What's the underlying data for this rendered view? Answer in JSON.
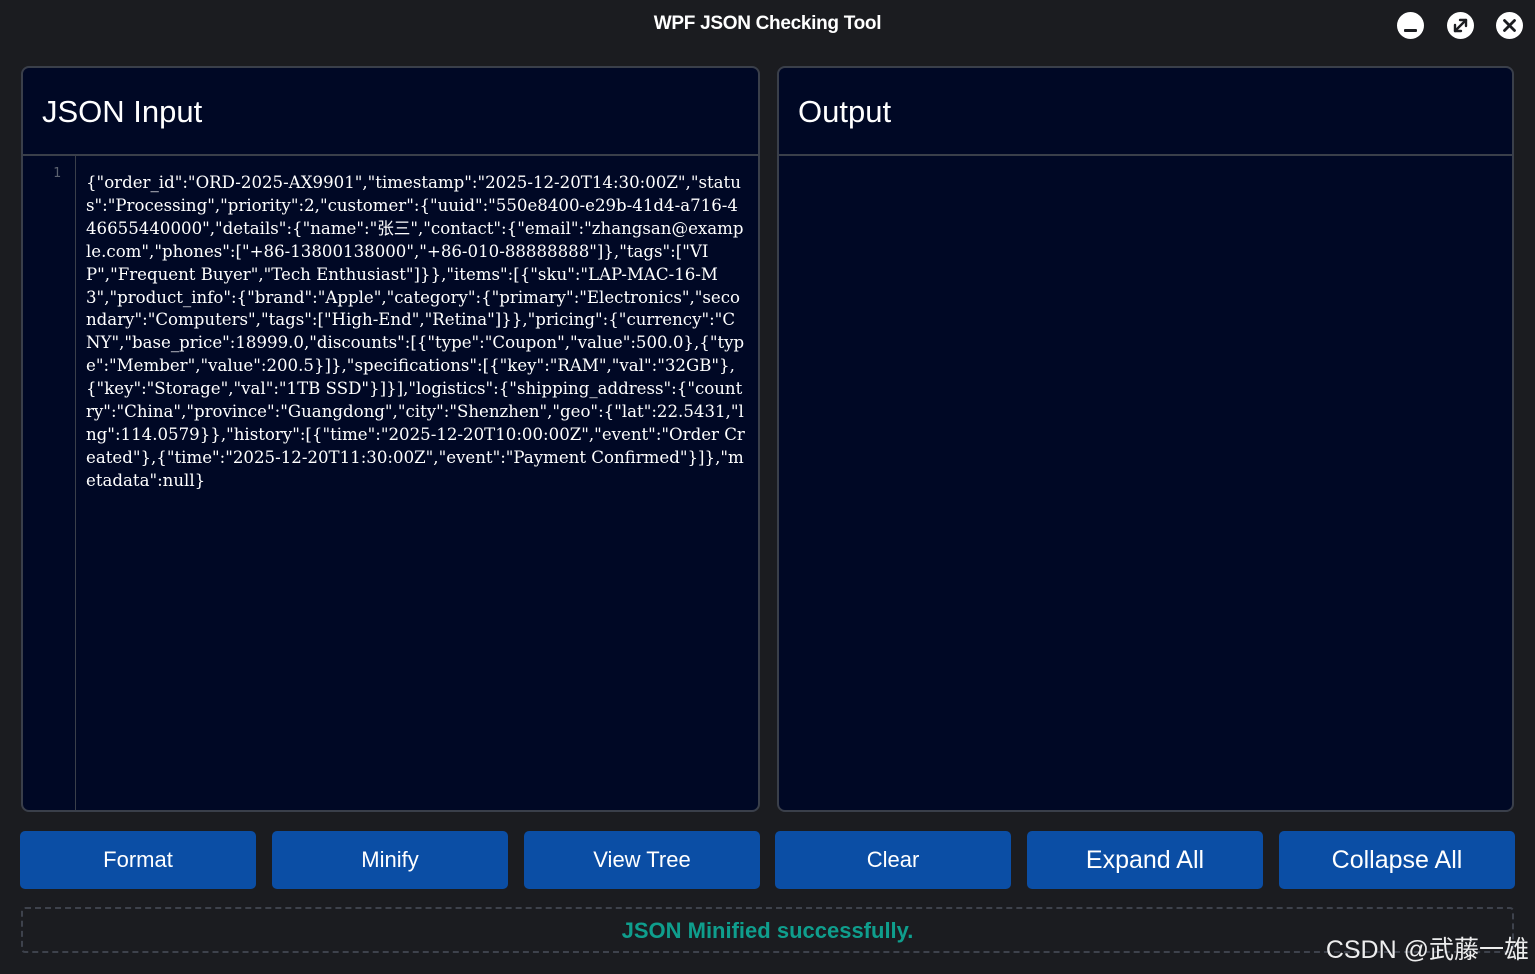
{
  "window": {
    "title": "WPF JSON Checking Tool"
  },
  "input_panel": {
    "title": "JSON Input",
    "line_number": "1",
    "content": "{\"order_id\":\"ORD-2025-AX9901\",\"timestamp\":\"2025-12-20T14:30:00Z\",\"status\":\"Processing\",\"priority\":2,\"customer\":{\"uuid\":\"550e8400-e29b-41d4-a716-446655440000\",\"details\":{\"name\":\"张三\",\"contact\":{\"email\":\"zhangsan@example.com\",\"phones\":[\"+86-13800138000\",\"+86-010-88888888\"]},\"tags\":[\"VIP\",\"Frequent Buyer\",\"Tech Enthusiast\"]}},\"items\":[{\"sku\":\"LAP-MAC-16-M3\",\"product_info\":{\"brand\":\"Apple\",\"category\":{\"primary\":\"Electronics\",\"secondary\":\"Computers\",\"tags\":[\"High-End\",\"Retina\"]}},\"pricing\":{\"currency\":\"CNY\",\"base_price\":18999.0,\"discounts\":[{\"type\":\"Coupon\",\"value\":500.0},{\"type\":\"Member\",\"value\":200.5}]},\"specifications\":[{\"key\":\"RAM\",\"val\":\"32GB\"},{\"key\":\"Storage\",\"val\":\"1TB SSD\"}]}],\"logistics\":{\"shipping_address\":{\"country\":\"China\",\"province\":\"Guangdong\",\"city\":\"Shenzhen\",\"geo\":{\"lat\":22.5431,\"lng\":114.0579}},\"history\":[{\"time\":\"2025-12-20T10:00:00Z\",\"event\":\"Order Created\"},{\"time\":\"2025-12-20T11:30:00Z\",\"event\":\"Payment Confirmed\"}]},\"metadata\":null}"
  },
  "output_panel": {
    "title": "Output"
  },
  "buttons": {
    "format": "Format",
    "minify": "Minify",
    "view_tree": "View Tree",
    "clear": "Clear",
    "expand_all": "Expand All",
    "collapse_all": "Collapse All"
  },
  "status": {
    "message": "JSON Minified successfully."
  },
  "watermark": "CSDN @武藤一雄",
  "colors": {
    "background": "#1b1c20",
    "panel": "#000825",
    "button": "#0b4ea5",
    "status_text": "#0f9e8d"
  }
}
